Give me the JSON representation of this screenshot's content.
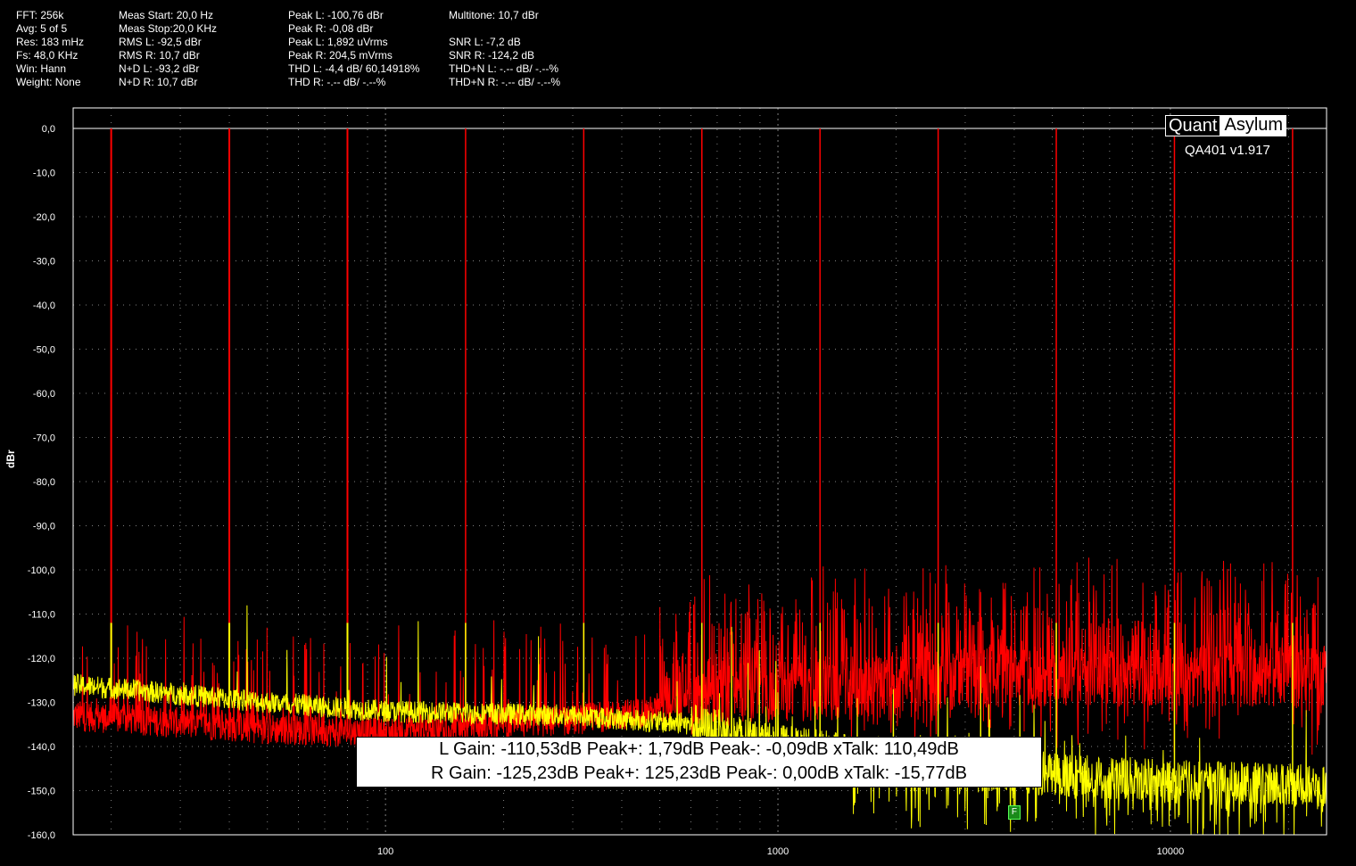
{
  "stats": {
    "col1": [
      "FFT: 256k",
      "Avg: 5 of 5",
      "Res: 183 mHz",
      "Fs: 48,0 KHz",
      "Win: Hann",
      "Weight: None"
    ],
    "col2": [
      "Meas Start: 20,0 Hz",
      "Meas Stop:20,0 KHz",
      "RMS L: -92,5 dBr",
      "RMS R: 10,7 dBr",
      "N+D L: -93,2 dBr",
      "N+D R: 10,7 dBr"
    ],
    "col3": [
      "Peak L: -100,76 dBr",
      "Peak R: -0,08 dBr",
      "Peak L: 1,892 uVrms",
      "Peak R: 204,5 mVrms",
      "THD L: -4,4 dB/ 60,14918%",
      "THD R: -.-- dB/ -.--%"
    ],
    "col4": [
      "Multitone: 10,7  dBr",
      "",
      "SNR L: -7,2 dB",
      "SNR R: -124,2 dB",
      "THD+N L: -.-- dB/ -.--%",
      "THD+N R: -.-- dB/ -.--%"
    ]
  },
  "logo": {
    "left": "Quant",
    "right": "Asylum",
    "version": "QA401 v1.917"
  },
  "result_box": {
    "line1": "L Gain: -110,53dB  Peak+: 1,79dB  Peak-: -0,09dB  xTalk: 110,49dB",
    "line2": "R Gain: -125,23dB  Peak+: 125,23dB  Peak-: 0,00dB  xTalk: -15,77dB"
  },
  "marker_label": "F",
  "colors": {
    "background": "#000000",
    "left_channel": "#ff0000",
    "right_channel": "#ffff00",
    "grid": "#808080",
    "marker": "#1a8a1a"
  },
  "chart_data": {
    "type": "line",
    "ylabel": "dBr",
    "x_scale": "log",
    "xlim": [
      16,
      25000
    ],
    "ylim": [
      -160,
      0
    ],
    "grid": true,
    "x_tick_labels": [
      {
        "value": 100,
        "label": "100"
      },
      {
        "value": 1000,
        "label": "1000"
      },
      {
        "value": 10000,
        "label": "10000"
      }
    ],
    "y_ticks": [
      {
        "value": 0,
        "label": "0,0"
      },
      {
        "value": -10,
        "label": "-10,0"
      },
      {
        "value": -20,
        "label": "-20,0"
      },
      {
        "value": -30,
        "label": "-30,0"
      },
      {
        "value": -40,
        "label": "-40,0"
      },
      {
        "value": -50,
        "label": "-50,0"
      },
      {
        "value": -60,
        "label": "-60,0"
      },
      {
        "value": -70,
        "label": "-70,0"
      },
      {
        "value": -80,
        "label": "-80,0"
      },
      {
        "value": -90,
        "label": "-90,0"
      },
      {
        "value": -100,
        "label": "-100,0"
      },
      {
        "value": -110,
        "label": "-110,0"
      },
      {
        "value": -120,
        "label": "-120,0"
      },
      {
        "value": -130,
        "label": "-130,0"
      },
      {
        "value": -140,
        "label": "-140,0"
      },
      {
        "value": -150,
        "label": "-150,0"
      },
      {
        "value": -160,
        "label": "-160,0"
      }
    ],
    "series": [
      {
        "channel": "left",
        "color": "#ff0000",
        "tones_hz": [
          20,
          40,
          80,
          160,
          320,
          640,
          1280,
          2560,
          5120,
          10240,
          20480
        ],
        "tone_level_db": 0,
        "noise_floor": [
          [
            16,
            -133
          ],
          [
            50,
            -136
          ],
          [
            100,
            -137
          ],
          [
            300,
            -134
          ],
          [
            600,
            -131
          ],
          [
            800,
            -128
          ],
          [
            1500,
            -127
          ],
          [
            4000,
            -124
          ],
          [
            10000,
            -124
          ],
          [
            25000,
            -124
          ]
        ]
      },
      {
        "channel": "right",
        "color": "#ffff00",
        "tones_hz": [
          20,
          40,
          80,
          160,
          320,
          640,
          1280,
          2560,
          5120,
          10240,
          20480
        ],
        "tone_level_db": -112,
        "noise_floor": [
          [
            16,
            -126
          ],
          [
            50,
            -130
          ],
          [
            100,
            -132
          ],
          [
            300,
            -133
          ],
          [
            600,
            -135
          ],
          [
            1000,
            -140
          ],
          [
            3000,
            -145
          ],
          [
            10000,
            -148
          ],
          [
            25000,
            -149
          ]
        ]
      }
    ],
    "marker": {
      "x": 4000,
      "y": -155
    }
  }
}
